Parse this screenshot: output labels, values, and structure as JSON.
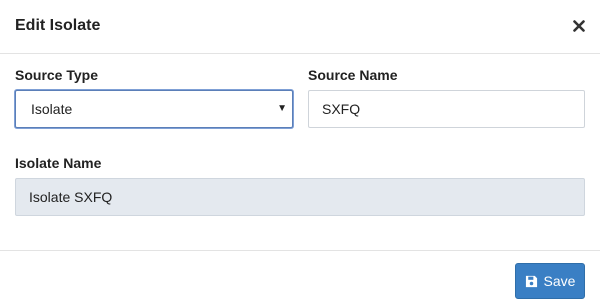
{
  "dialog": {
    "title": "Edit Isolate",
    "close_icon": "close-icon"
  },
  "form": {
    "source_type": {
      "label": "Source Type",
      "value": "Isolate",
      "options": [
        "Isolate"
      ]
    },
    "source_name": {
      "label": "Source Name",
      "value": "SXFQ"
    },
    "isolate_name": {
      "label": "Isolate Name",
      "value": "Isolate SXFQ"
    }
  },
  "footer": {
    "save_label": "Save",
    "save_icon": "floppy-disk-icon"
  },
  "colors": {
    "primary": "#3a7fc4",
    "readonly_bg": "#e4e9ef"
  }
}
